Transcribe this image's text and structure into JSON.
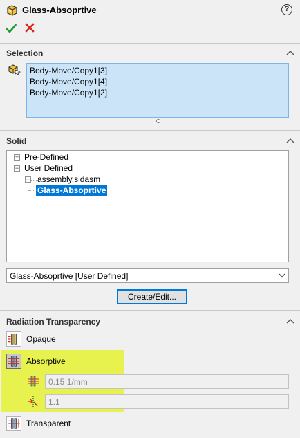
{
  "header": {
    "title": "Glass-Absoprtive",
    "help_symbol": "?"
  },
  "selection": {
    "title": "Selection",
    "items": [
      "Body-Move/Copy1[3]",
      "Body-Move/Copy1[4]",
      "Body-Move/Copy1[2]"
    ]
  },
  "solid": {
    "title": "Solid",
    "tree": {
      "predefined": "Pre-Defined",
      "user_defined": "User Defined",
      "assembly": "assembly.sldasm",
      "selected": "Glass-Absoprtive"
    },
    "dropdown_value": "Glass-Absoprtive [User Defined]",
    "create_edit_label": "Create/Edit..."
  },
  "radiation": {
    "title": "Radiation Transparency",
    "options": {
      "opaque": "Opaque",
      "absorptive": "Absorptive",
      "transparent": "Transparent"
    },
    "absorption_coefficient": "0.15 1/mm",
    "refractive_index": "1.1"
  },
  "colors": {
    "highlight": "#e7f24f",
    "selection_bg": "#cce4f7",
    "tree_selected": "#0078d7",
    "ok_green": "#1f9e2f",
    "cancel_red": "#d9261c"
  },
  "icons": {
    "ok": "checkmark-icon",
    "cancel": "x-icon",
    "help": "question-circle-icon",
    "collapse": "chevron-up-icon"
  }
}
